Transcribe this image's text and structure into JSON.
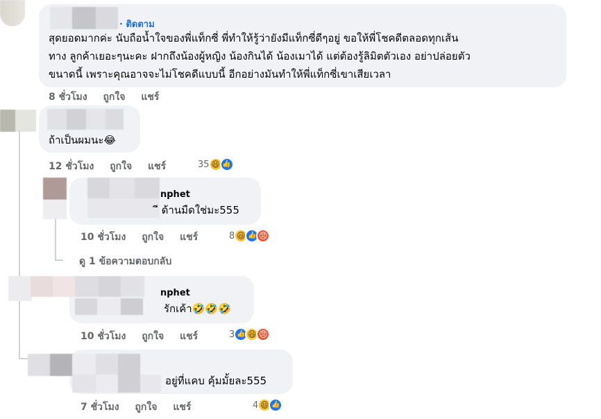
{
  "comments": [
    {
      "follow_label": "· ติดตาม",
      "lines": [
        "สุดยอดมากค่ะ นับถือน้ำใจของพี่แท็กซี่ พี่ทำให้รู้ว่ายังมีแท็กซี่ดีๆอยู่ ขอให้พี่โชคดีตลอดทุกเส้น",
        "ทาง ลูกค้าเยอะๆนะคะ ฝากถึงน้องผู้หญิง น้องกินได้ น้องเมาได้ แต่ต้องรู้ลิมิตตัวเอง อย่าปล่อยตัว",
        "ขนาดนี้ เพราะคุณอาจจะไม่โชคดีแบบนี้ อีกอย่างมันทำให้พี่แท็กซี่เขาเสียเวลา"
      ],
      "time": "8 ชั่วโมง",
      "like": "ถูกใจ",
      "share": "แชร์"
    },
    {
      "lines": [
        "ถ้าเป็นผมนะ😂"
      ],
      "time": "12 ชั่วโมง",
      "like": "ถูกใจ",
      "share": "แชร์",
      "reaction_count": "35"
    }
  ],
  "replies": [
    {
      "name_partial": "nphet",
      "text": "ี ด้านมืดใช่มะ555",
      "time": "10 ชั่วโมง",
      "like": "ถูกใจ",
      "share": "แชร์",
      "reaction_count": "8"
    },
    {
      "name_partial": "nphet",
      "text": "รักเค้า🤣🤣🤣",
      "time": "10 ชั่วโมง",
      "like": "ถูกใจ",
      "share": "แชร์",
      "reaction_count": "3"
    },
    {
      "text": "อยู่ที่แคบ คุ้มมั้ยละ555",
      "time": "7 ชั่วโมง",
      "like": "ถูกใจ",
      "share": "แชร์",
      "reaction_count": "4"
    }
  ],
  "view_replies_label": "ดู 1 ข้อความตอบกลับ",
  "colors": {
    "bubble": "#f0f2f5",
    "meta_text": "#65676b",
    "follow": "#216fdb",
    "like_blue": "#1877f2",
    "haha_yellow": "#f7c434",
    "angry_red": "#f0532d"
  },
  "icons": [
    "haha-reaction-icon",
    "like-reaction-icon",
    "angry-reaction-icon"
  ]
}
